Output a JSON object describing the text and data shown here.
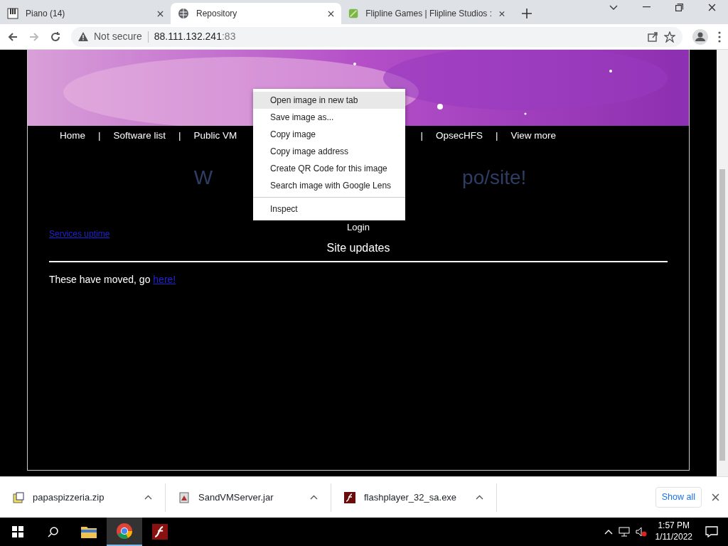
{
  "tabs": [
    {
      "title": "Piano (14)",
      "selected": false
    },
    {
      "title": "Repository",
      "selected": true
    },
    {
      "title": "Flipline Games | Flipline Studios :",
      "selected": false
    }
  ],
  "address_bar": {
    "security": "Not secure",
    "host": "88.111.132.241",
    "port": ":83"
  },
  "page": {
    "nav_left": [
      {
        "label": "Home"
      },
      {
        "label": "Software list"
      },
      {
        "label": "Public VM"
      }
    ],
    "nav_right": [
      {
        "label": "OpsecHFS"
      },
      {
        "label": "View more"
      }
    ],
    "separator": "|",
    "heading_left": "W",
    "heading_right": "po/site!",
    "login": "Login",
    "uptime_link": "Services uptime",
    "section_title": "Site updates",
    "moved_text": "These have moved, go ",
    "moved_link": "here!"
  },
  "context_menu": {
    "groups": [
      [
        {
          "label": "Open image in new tab",
          "selected": true
        },
        {
          "label": "Save image as...",
          "selected": false
        },
        {
          "label": "Copy image",
          "selected": false
        },
        {
          "label": "Copy image address",
          "selected": false
        },
        {
          "label": "Create QR Code for this image",
          "selected": false
        },
        {
          "label": "Search image with Google Lens",
          "selected": false
        }
      ],
      [
        {
          "label": "Inspect",
          "selected": false
        }
      ]
    ]
  },
  "downloads": [
    {
      "file": "papaspizzeria.zip",
      "kind": "zip"
    },
    {
      "file": "SandVMServer.jar",
      "kind": "jar"
    },
    {
      "file": "flashplayer_32_sa.exe",
      "kind": "flash"
    }
  ],
  "show_all": "Show all",
  "taskbar": {
    "time": "1:57 PM",
    "date": "1/11/2022",
    "apps": [
      {
        "kind": "folder",
        "selected": false
      },
      {
        "kind": "chrome",
        "selected": true
      },
      {
        "kind": "flash",
        "selected": false
      }
    ]
  }
}
